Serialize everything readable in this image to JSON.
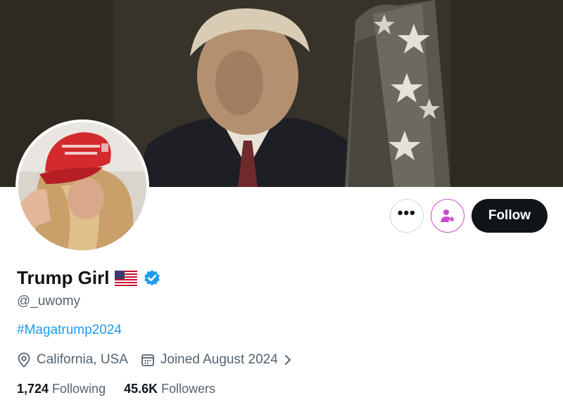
{
  "profile": {
    "display_name": "Trump Girl",
    "handle": "@_uwomy",
    "bio": "#Magatrump2024",
    "location": "California, USA",
    "joined": "Joined August 2024",
    "following_count": "1,724",
    "following_label": "Following",
    "followers_count": "45.6K",
    "followers_label": "Followers"
  },
  "actions": {
    "more_label": "•••",
    "follow_label": "Follow"
  },
  "colors": {
    "accent_link": "#1d9bf0",
    "verified": "#1d9bf0",
    "subscribe_border": "#c84ad0",
    "follow_bg": "#0f1419",
    "secondary_text": "#536471"
  },
  "icons": {
    "location": "map-pin-icon",
    "joined": "calendar-icon",
    "chevron": "chevron-right-icon",
    "verified": "verified-badge-icon",
    "flag": "us-flag-icon",
    "subscribe": "person-star-icon"
  }
}
